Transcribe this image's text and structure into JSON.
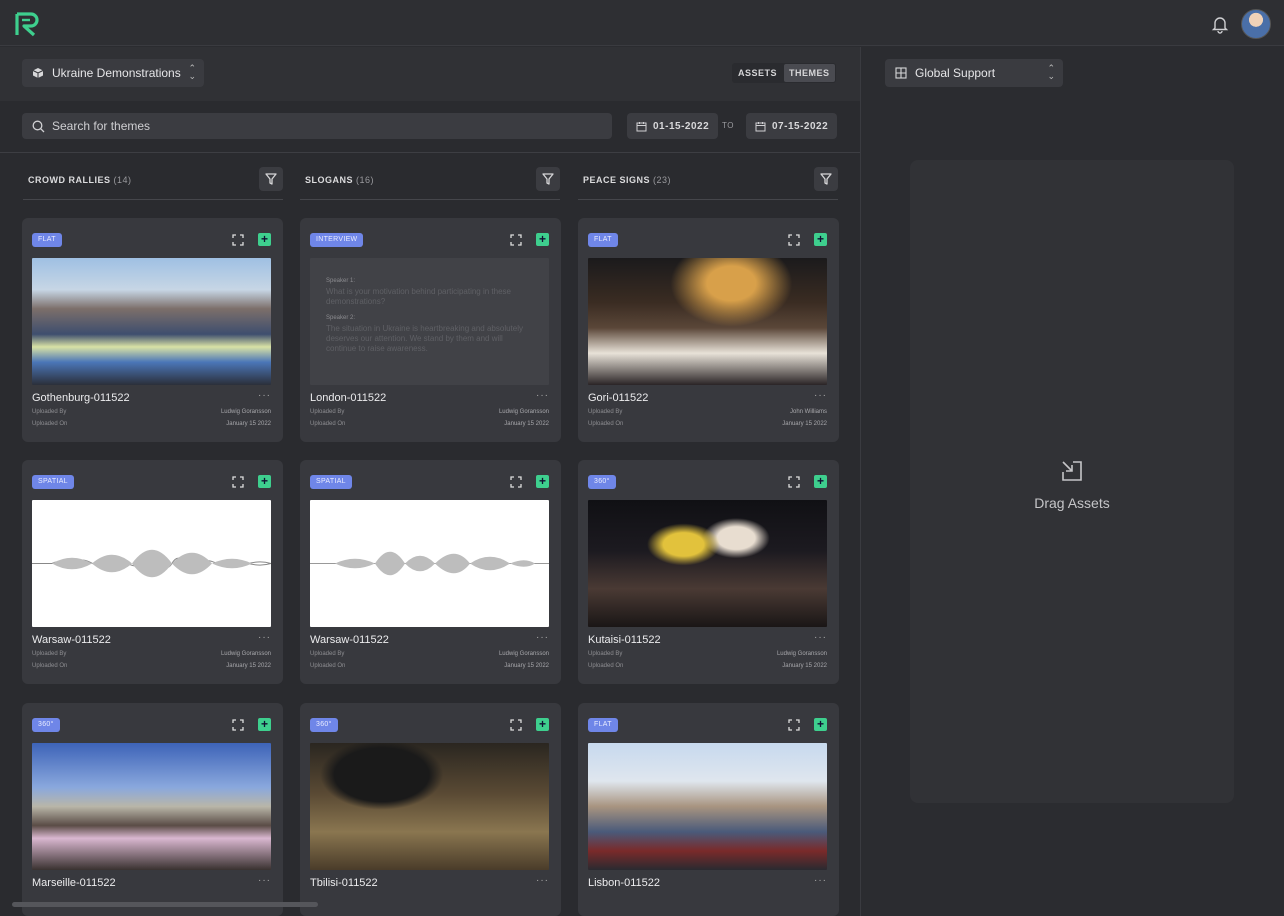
{
  "header": {
    "logo": "R-logo-icon",
    "notifications_icon": "bell-icon",
    "avatar": "user-avatar"
  },
  "toolbar": {
    "project": "Ukraine Demonstrations",
    "view_tabs": [
      "ASSETS",
      "THEMES"
    ],
    "active_view": "THEMES"
  },
  "search": {
    "placeholder": "Search for themes",
    "date_from": "01-15-2022",
    "date_to_label": "TO",
    "date_to": "07-15-2022"
  },
  "columns": [
    {
      "title": "CROWD RALLIES",
      "count": "(14)",
      "cards": [
        {
          "badge": "FLAT",
          "name": "Gothenburg-011522",
          "uploaded_by_label": "Uploaded By",
          "uploaded_by": "Ludwig Goransson",
          "uploaded_on_label": "Uploaded On",
          "uploaded_on": "January 15 2022"
        },
        {
          "badge": "SPATIAL",
          "name": "Warsaw-011522",
          "uploaded_by_label": "Uploaded By",
          "uploaded_by": "Ludwig Goransson",
          "uploaded_on_label": "Uploaded On",
          "uploaded_on": "January 15 2022"
        },
        {
          "badge": "360°",
          "name": "Marseille-011522"
        }
      ]
    },
    {
      "title": "SLOGANS",
      "count": "(16)",
      "cards": [
        {
          "badge": "INTERVIEW",
          "name": "London-011522",
          "uploaded_by_label": "Uploaded By",
          "uploaded_by": "Ludwig Goransson",
          "uploaded_on_label": "Uploaded On",
          "uploaded_on": "January 15 2022",
          "transcript": [
            {
              "speaker": "Speaker 1:",
              "text": "What is your motivation behind participating in these demonstrations?"
            },
            {
              "speaker": "Speaker 2:",
              "text": "The situation in Ukraine is heartbreaking and absolutely deserves our attention. We stand by them and will continue to raise awareness."
            }
          ]
        },
        {
          "badge": "SPATIAL",
          "name": "Warsaw-011522",
          "uploaded_by_label": "Uploaded By",
          "uploaded_by": "Ludwig Goransson",
          "uploaded_on_label": "Uploaded On",
          "uploaded_on": "January 15 2022"
        },
        {
          "badge": "360°",
          "name": "Tbilisi-011522"
        }
      ]
    },
    {
      "title": "PEACE SIGNS",
      "count": "(23)",
      "cards": [
        {
          "badge": "FLAT",
          "name": "Gori-011522",
          "uploaded_by_label": "Uploaded By",
          "uploaded_by": "John Williams",
          "uploaded_on_label": "Uploaded On",
          "uploaded_on": "January 15 2022"
        },
        {
          "badge": "360°",
          "name": "Kutaisi-011522",
          "uploaded_by_label": "Uploaded By",
          "uploaded_by": "Ludwig Goransson",
          "uploaded_on_label": "Uploaded On",
          "uploaded_on": "January 15 2022"
        },
        {
          "badge": "FLAT",
          "name": "Lisbon-011522"
        }
      ]
    }
  ],
  "right_panel": {
    "workspace": "Global Support",
    "drop_label": "Drag Assets"
  },
  "colors": {
    "accent_green": "#3ecf8e",
    "badge_blue": "#6f86e8"
  }
}
